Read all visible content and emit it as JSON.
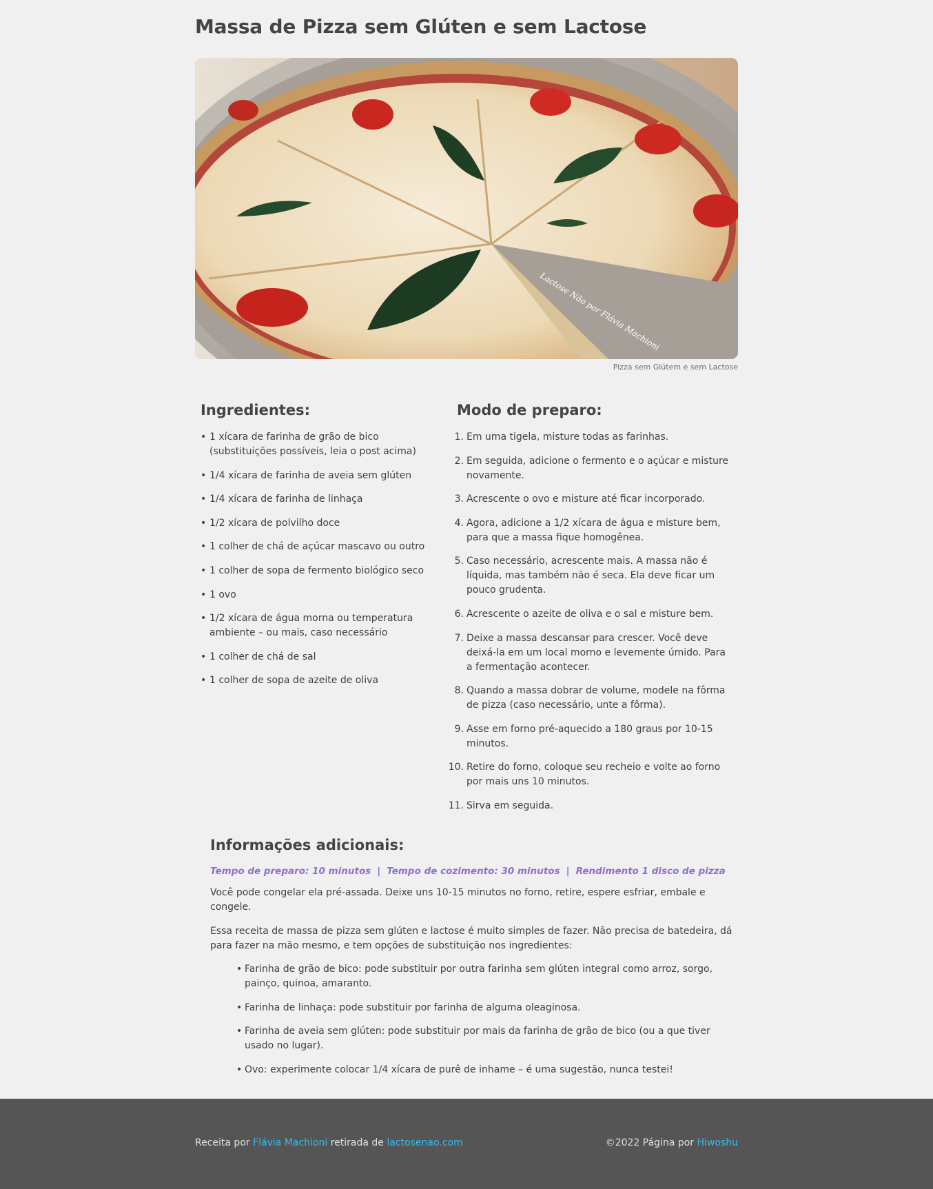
{
  "page": {
    "title": "Massa de Pizza sem Glúten e sem Lactose"
  },
  "hero": {
    "watermark": "Lactose Não por Flávia Machioni",
    "caption": "Pizza sem Glútem e sem Lactose"
  },
  "ingredients": {
    "heading": "Ingredientes:",
    "items": [
      "1 xícara de farinha de grão de bico (substituições possíveis, leia o post acima)",
      "1/4 xícara de farinha de aveia sem glúten",
      "1/4 xícara de farinha de linhaça",
      "1/2 xícara de polvilho doce",
      "1 colher de chá de açúcar mascavo ou outro",
      "1 colher de sopa de fermento biológico seco",
      "1 ovo",
      "1/2 xícara de água morna ou temperatura ambiente – ou mais, caso necessário",
      "1 colher de chá de sal",
      "1 colher de sopa de azeite de oliva"
    ]
  },
  "steps": {
    "heading": "Modo de preparo:",
    "items": [
      "Em uma tigela, misture todas as farinhas.",
      "Em seguida, adicione o fermento e o açúcar e misture novamente.",
      "Acrescente o ovo e misture até ficar incorporado.",
      "Agora, adicione a 1/2 xícara de água e misture bem, para que a massa fique homogênea.",
      "Caso necessário, acrescente mais. A massa não é líquida, mas também não é seca. Ela deve ficar um pouco grudenta.",
      "Acrescente o azeite de oliva e o sal e misture bem.",
      "Deixe a massa descansar para crescer. Você deve deixá-la em um local morno e levemente úmido. Para a fermentação acontecer.",
      "Quando a massa dobrar de volume, modele na fôrma de pizza (caso necessário, unte a fôrma).",
      "Asse em forno pré-aquecido a 180 graus por 10-15 minutos.",
      "Retire do forno, coloque seu recheio e volte ao forno por mais uns 10 minutos.",
      "Sirva em seguida."
    ]
  },
  "info": {
    "heading": "Informações adicionais:",
    "prep_time": "Tempo de preparo: 10 minutos",
    "cook_time": "Tempo de cozimento: 30 minutos",
    "yield": "Rendimento 1 disco de pizza",
    "separator": "|",
    "paragraph1": "Você pode congelar ela pré-assada. Deixe uns 10-15 minutos no forno, retire, espere esfriar, embale e congele.",
    "paragraph2": "Essa receita de massa de pizza sem glúten e lactose é muito simples de fazer. Não precisa de batedeira, dá para fazer na mão mesmo, e tem opções de substituição nos ingredientes:",
    "substitutions": [
      "Farinha de grão de bico: pode substituir por outra farinha sem glúten integral como arroz, sorgo, painço, quinoa, amaranto.",
      "Farinha de linhaça: pode substituir por farinha de alguma oleaginosa.",
      "Farinha de aveia sem glúten: pode substituir por mais da farinha de grão de bico (ou a que tiver usado no lugar).",
      "Ovo: experimente colocar 1/4 xícara de purê de inhame – é uma sugestão, nunca testei!"
    ]
  },
  "footer": {
    "recipe_by": "Receita por",
    "author": "Flávia Machioni",
    "taken_from": "retirada de",
    "source": "lactosenao.com",
    "copyright": "©2022 Página por",
    "page_author": "Hiwoshu"
  },
  "colors": {
    "background": "#f0f0f0",
    "text": "#3f3f3f",
    "accent_meta": "#9070d0",
    "footer_bg": "#555555",
    "link": "#33bbee"
  }
}
